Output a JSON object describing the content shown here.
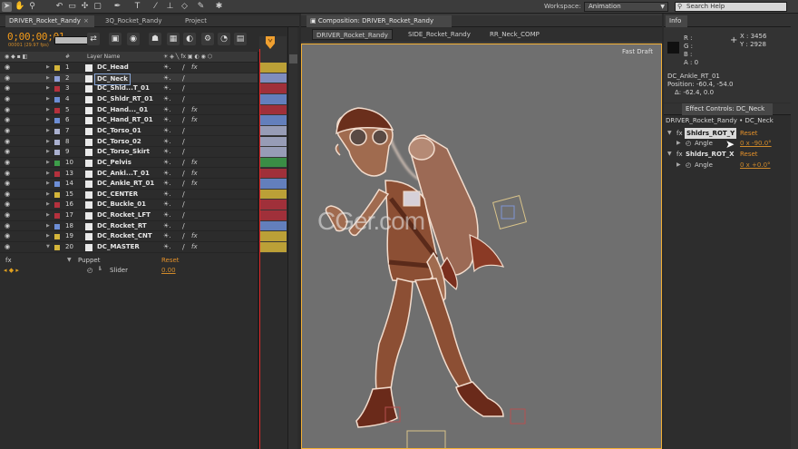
{
  "toolbar": {
    "tools": [
      "selection-tool",
      "hand-tool",
      "zoom-tool",
      "rotate-tool",
      "camera-tool",
      "pan-behind-tool",
      "rectangle-tool",
      "pen-tool",
      "type-tool",
      "brush-tool",
      "clone-stamp-tool",
      "eraser-tool",
      "roto-brush-tool",
      "puppet-tool"
    ],
    "workspace_label": "Workspace:",
    "workspace_value": "Animation",
    "search_placeholder": "Search Help"
  },
  "timeline": {
    "tabs": [
      "DRIVER_Rocket_Randy",
      "3Q_Rocket_Randy",
      "Project"
    ],
    "timecode": "0;00;00;01",
    "sub_timecode": "00001 (29.97 fps)",
    "header": {
      "hash": "#",
      "layer_name": "Layer Name"
    },
    "layers": [
      {
        "num": "1",
        "name": "DC_Head",
        "color": "#d4b53a",
        "fx": true
      },
      {
        "num": "2",
        "name": "DC_Neck",
        "color": "#8e9fd8",
        "fx": false,
        "selected": true
      },
      {
        "num": "3",
        "name": "DC_Shld...T_01",
        "color": "#b5313d",
        "fx": false
      },
      {
        "num": "4",
        "name": "DC_Shldr_RT_01",
        "color": "#6d8ed6",
        "fx": false
      },
      {
        "num": "5",
        "name": "DC_Hand..._01",
        "color": "#b5313d",
        "fx": true
      },
      {
        "num": "6",
        "name": "DC_Hand_RT_01",
        "color": "#6d8ed6",
        "fx": true
      },
      {
        "num": "7",
        "name": "DC_Torso_01",
        "color": "#aab0cf",
        "fx": false
      },
      {
        "num": "8",
        "name": "DC_Torso_02",
        "color": "#aab0cf",
        "fx": false
      },
      {
        "num": "9",
        "name": "DC_Torso_Skirt",
        "color": "#aab0cf",
        "fx": false
      },
      {
        "num": "10",
        "name": "DC_Pelvis",
        "color": "#3d9e4a",
        "fx": true
      },
      {
        "num": "13",
        "name": "DC_Ankl...T_01",
        "color": "#b5313d",
        "fx": true
      },
      {
        "num": "14",
        "name": "DC_Ankle_RT_01",
        "color": "#6d8ed6",
        "fx": true
      },
      {
        "num": "15",
        "name": "DC_CENTER",
        "color": "#d4b53a",
        "fx": false
      },
      {
        "num": "16",
        "name": "DC_Buckle_01",
        "color": "#b5313d",
        "fx": false
      },
      {
        "num": "17",
        "name": "DC_Rocket_LFT",
        "color": "#b5313d",
        "fx": false
      },
      {
        "num": "18",
        "name": "DC_Rocket_RT",
        "color": "#6d8ed6",
        "fx": false
      },
      {
        "num": "19",
        "name": "DC_Rocket_CNT",
        "color": "#d4b53a",
        "fx": true
      },
      {
        "num": "20",
        "name": "DC_MASTER",
        "color": "#d4b53a",
        "fx": true
      }
    ],
    "effect": {
      "fx": "fx",
      "name": "Puppet",
      "reset": "Reset"
    },
    "property": {
      "name": "Slider",
      "value": "0.00"
    }
  },
  "composition": {
    "tab": "Composition: DRIVER_Rocket_Randy",
    "subtabs": [
      "DRIVER_Rocket_Randy",
      "SIDE_Rocket_Randy",
      "RR_Neck_COMP"
    ],
    "fast_draft": "Fast Draft",
    "watermark": "CGer.com"
  },
  "info": {
    "tab": "Info",
    "r": "R :",
    "g": "G :",
    "b": "B :",
    "a": "A : 0",
    "x": "X : 3456",
    "y": "Y : 2928",
    "layer": "DC_Ankle_RT_01",
    "position": "Position: -60.4, -54.0",
    "delta": "Δ: -62.4, 0.0"
  },
  "effect_controls": {
    "tab": "Effect Controls: DC_Neck",
    "breadcrumb": "DRIVER_Rocket_Randy • DC_Neck",
    "effects": [
      {
        "fx": "fx",
        "name": "Shldrs_ROT_Y",
        "reset": "Reset",
        "prop": "Angle",
        "value": "0 x -90.0°"
      },
      {
        "fx": "fx",
        "name": "Shldrs_ROT_X",
        "reset": "Reset",
        "prop": "Angle",
        "value": "0 x +0.0°"
      }
    ]
  }
}
